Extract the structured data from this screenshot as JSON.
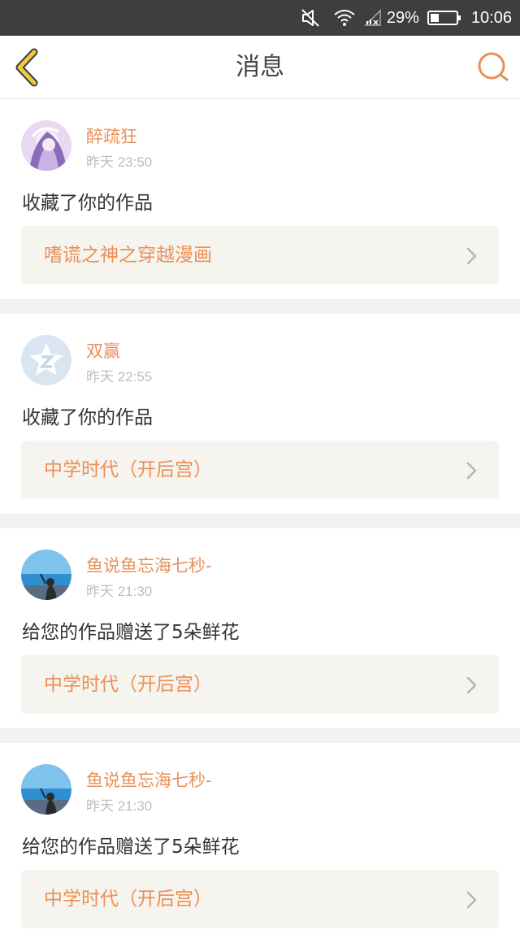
{
  "status_bar": {
    "battery": "29%",
    "time": "10:06",
    "icons": [
      "mute-icon",
      "wifi-icon",
      "no-signal-icon",
      "battery-icon"
    ]
  },
  "header": {
    "title": "消息",
    "back_icon": "chevron-left-icon",
    "search_icon": "search-icon"
  },
  "colors": {
    "accent": "#e8905a",
    "back_icon": "#e8c03c",
    "link_bg": "#f5f4ef",
    "time": "#bdbdbd"
  },
  "messages": [
    {
      "user": "醉疏狂",
      "time": "昨天 23:50",
      "text": "收藏了你的作品",
      "work": "嗜谎之神之穿越漫画",
      "avatar": "anime-avatar"
    },
    {
      "user": "双赢",
      "time": "昨天 22:55",
      "text": "收藏了你的作品",
      "work": "中学时代（开后宫）",
      "avatar": "default-avatar"
    },
    {
      "user": "鱼说鱼忘海七秒-",
      "time": "昨天 21:30",
      "text": "给您的作品赠送了5朵鲜花",
      "work": "中学时代（开后宫）",
      "avatar": "beach-avatar"
    },
    {
      "user": "鱼说鱼忘海七秒-",
      "time": "昨天 21:30",
      "text": "给您的作品赠送了5朵鲜花",
      "work": "中学时代（开后宫）",
      "avatar": "beach-avatar"
    }
  ]
}
